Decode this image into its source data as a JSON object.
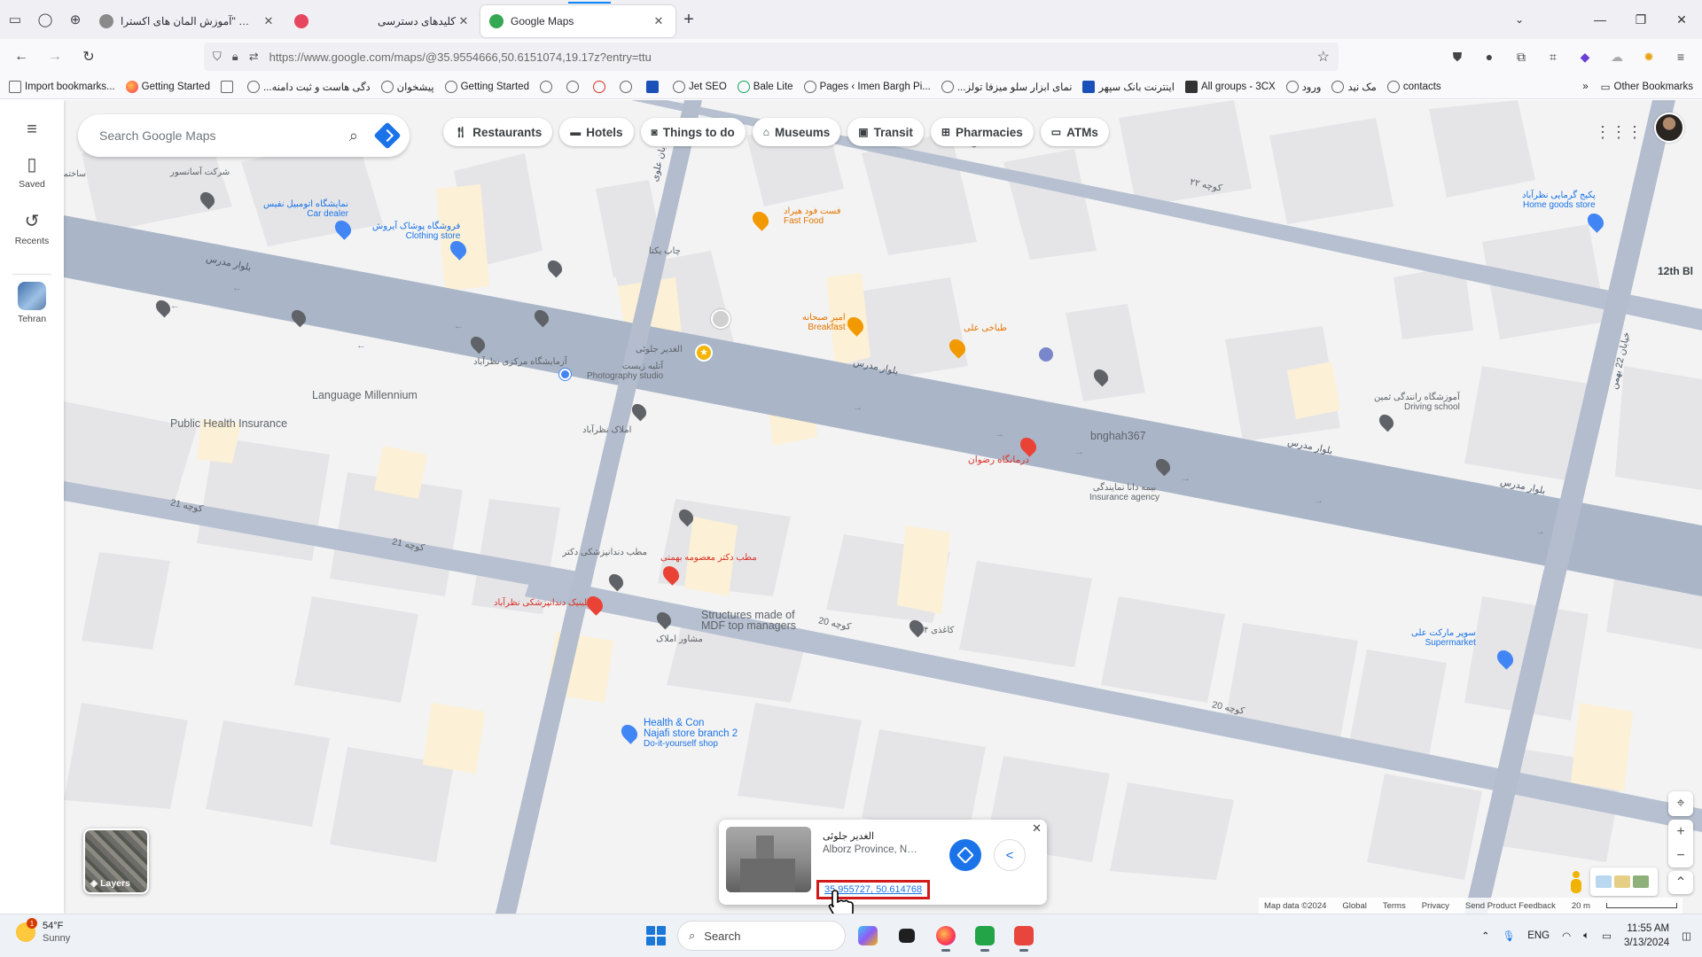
{
  "browser": {
    "tabs": [
      {
        "title": "ویرایش \"آموزش المان های اکسترا...",
        "favicon_color": "#8a8a8a"
      },
      {
        "title": "کلیدهای دسترسی",
        "favicon_color": "#e8455e"
      },
      {
        "title": "Google Maps",
        "favicon_color": "#34a853"
      }
    ],
    "url": "https://www.google.com/maps/@35.9554666,50.6151074,19.17z?entry=ttu",
    "bookmarks": [
      "Import bookmarks...",
      "Getting Started",
      "...دگی هاست و ثبت دامنه",
      "پیشخوان",
      "Getting Started",
      "Jet SEO",
      "Bale Lite",
      "Pages ‹ Imen Bargh Pi...",
      "...نمای ابزار سلو میزفا تولز",
      "اینترنت بانک سپهر",
      "All groups - 3CX",
      "ورود",
      "مک نید",
      "contacts"
    ],
    "other_bookmarks": "Other Bookmarks"
  },
  "maps": {
    "rail": {
      "saved": "Saved",
      "recents": "Recents",
      "tehran": "Tehran"
    },
    "search_placeholder": "Search Google Maps",
    "chips": [
      {
        "label": "Restaurants",
        "icon": "fork-knife-icon"
      },
      {
        "label": "Hotels",
        "icon": "bed-icon"
      },
      {
        "label": "Things to do",
        "icon": "camera-icon"
      },
      {
        "label": "Museums",
        "icon": "museum-icon"
      },
      {
        "label": "Transit",
        "icon": "train-icon"
      },
      {
        "label": "Pharmacies",
        "icon": "pharmacy-icon"
      },
      {
        "label": "ATMs",
        "icon": "atm-icon"
      }
    ],
    "layers_label": "Layers",
    "footer": {
      "map_data": "Map data ©2024",
      "global": "Global",
      "terms": "Terms",
      "privacy": "Privacy",
      "feedback": "Send Product Feedback",
      "scale": "20 m"
    },
    "labels": {
      "public_health": "Public Health Insurance",
      "language_millennium": "Language Millennium",
      "bnghah": "bnghah367",
      "structures_1": "Structures made of",
      "structures_2": "MDF top managers",
      "photography": "Photography studio",
      "fastfood": "Fast Food",
      "breakfast": "Breakfast",
      "car_dealer": "Car dealer",
      "clothing": "Clothing store",
      "home_goods": "Home goods store",
      "driving_school": "Driving school",
      "insurance_agency": "Insurance agency",
      "supermarket": "Supermarket",
      "health_1": "Health & Con",
      "health_2": "Najafi store branch 2",
      "health_3": "Do-it-yourself shop",
      "st_12th": "12th Bl",
      "fa_sakhteman": "ساختمان",
      "fa_ashrafi": "شرکت آسانسور",
      "fa_namayeshgah": "نمایشگاه اتومبیل نفیس",
      "fa_pooshak": "فروشگاه پوشاک آیروش",
      "fa_chap": "چاپ یکتا",
      "fa_atelieh": "آتلیه زیست",
      "fa_fastfood": "فست فود هیراد",
      "fa_sobhaneh": "امیر صبحانه",
      "fa_tabakhi": "طباخی علی",
      "fa_azmayesh": "آزمایشگاه مرکزی نظرآباد",
      "fa_ghadir": "الغدیر جلوئی",
      "fa_boulevard": "بلوار مدرس",
      "fa_amlak": "املاک نظرآباد",
      "fa_darmangah": "درمانگاه رضوان",
      "fa_bimeh": "بیمه دانا نمایندگی",
      "fa_rangchi": "آموزشگاه رانندگی ثمین",
      "fa_khorsand": "پکیج گرمایی نظرآباد",
      "fa_kucheh22": "کوچه ۲۲",
      "fa_kucheh21": "کوچه 21",
      "fa_kucheh20": "کوچه 20",
      "fa_kaghazi": "کاغذی ۴",
      "fa_matab": "مطب دکتر معصومه بهمنی",
      "fa_dadgostari": "مطب دندانپزشکی دکتر",
      "fa_mashavere": "مشاور املاک",
      "fa_supermarket": "سوپر مارکت علی",
      "fa_bahman22": "خیابان 22 بهمن",
      "fa_alavi": "خیابان علوی",
      "fa_clinic": "کلینیک دندانپزشکی نظرآباد"
    },
    "infocard": {
      "title": "الغدیر جلوئی",
      "subtitle": "Alborz Province, Nazara...",
      "coords": "35.955727, 50.614768"
    }
  },
  "taskbar": {
    "weather_temp": "54°F",
    "weather_desc": "Sunny",
    "weather_badge": "1",
    "search": "Search",
    "lang": "ENG",
    "time": "11:55 AM",
    "date": "3/13/2024"
  },
  "colors": {
    "road": "#aab6c8",
    "building": "#e4e4e6",
    "poi_yellow": "#fdf1d6",
    "accent_blue": "#1a73e8",
    "highlight_red": "#d11b1b"
  }
}
